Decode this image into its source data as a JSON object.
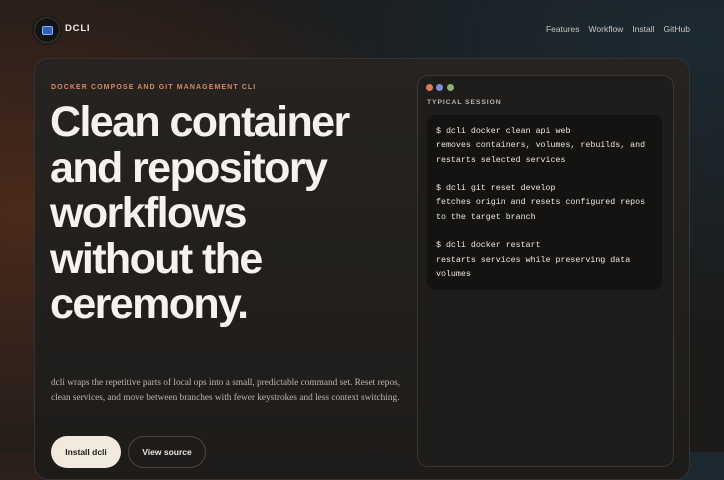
{
  "header": {
    "brand": "DCLI",
    "nav": [
      "Features",
      "Workflow",
      "Install",
      "GitHub"
    ]
  },
  "hero": {
    "eyebrow": "DOCKER COMPOSE AND GIT MANAGEMENT CLI",
    "headline": "Clean container and repository workflows without the ceremony.",
    "description": "dcli wraps the repetitive parts of local ops into a small, predictable command set. Reset repos, clean services, and move between branches with fewer keystrokes and less context switching.",
    "primary_button": "Install dcli",
    "secondary_button": "View source"
  },
  "terminal": {
    "label": "TYPICAL SESSION",
    "lines": [
      "$ dcli docker clean api web",
      "removes containers, volumes, rebuilds, and",
      "restarts selected services",
      "",
      "$ dcli git reset develop",
      "fetches origin and resets configured repos",
      "to the target branch",
      "",
      "$ dcli docker restart",
      "restarts services while preserving data",
      "volumes"
    ]
  },
  "colors": {
    "accent": "#d98a5d",
    "primary_button_bg": "#f2eadc",
    "dot_red": "#e07b5a",
    "dot_blue": "#7b8fd8",
    "dot_green": "#8fb07a"
  }
}
